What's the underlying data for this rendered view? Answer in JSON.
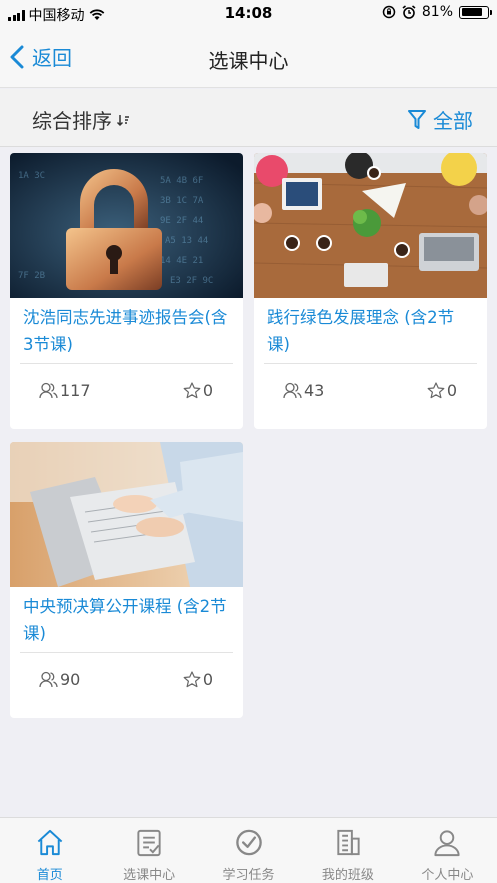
{
  "status": {
    "carrier": "中国移动",
    "time": "14:08",
    "battery": "81%",
    "battery_level": 0.81
  },
  "nav": {
    "back_label": "返回",
    "title": "选课中心"
  },
  "filter": {
    "sort_label": "综合排序",
    "filter_label": "全部"
  },
  "courses": [
    {
      "title": "沈浩同志先进事迹报告会(含3节课)",
      "learners": "117",
      "favorites": "0",
      "image": "padlock-photo"
    },
    {
      "title": "践行绿色发展理念 (含2节课)",
      "learners": "43",
      "favorites": "0",
      "image": "meeting-table-photo"
    },
    {
      "title": "中央预决算公开课程 (含2节课)",
      "learners": "90",
      "favorites": "0",
      "image": "laptop-typing-photo"
    }
  ],
  "tabs": [
    {
      "label": "首页",
      "icon": "home-icon",
      "active": true
    },
    {
      "label": "选课中心",
      "icon": "checklist-icon",
      "active": false
    },
    {
      "label": "学习任务",
      "icon": "check-circle-icon",
      "active": false
    },
    {
      "label": "我的班级",
      "icon": "building-icon",
      "active": false
    },
    {
      "label": "个人中心",
      "icon": "person-icon",
      "active": false
    }
  ],
  "colors": {
    "accent": "#1a8ad6",
    "background": "#efeff4",
    "tab_inactive": "#888888"
  }
}
